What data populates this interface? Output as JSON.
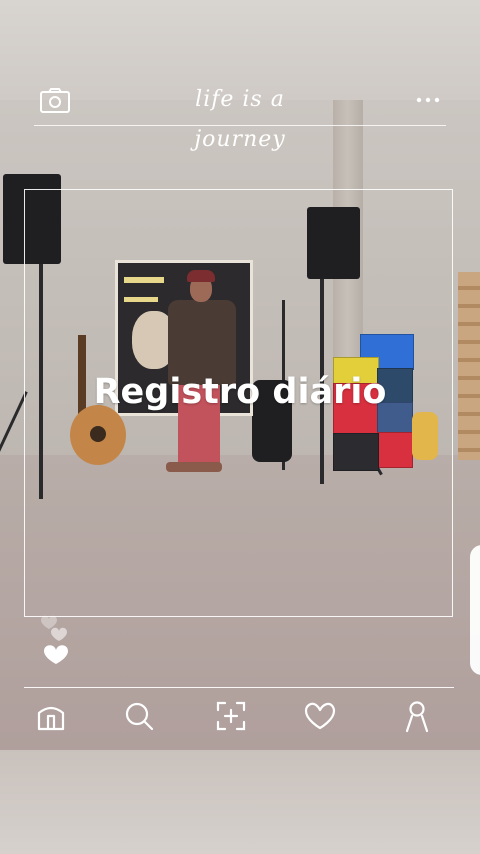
{
  "header": {
    "title": "life is a journey",
    "left_icon": "camera-icon",
    "right_icon": "more-dots-icon"
  },
  "caption": "Registro diário",
  "reactions": {
    "icon": "heart-icon"
  },
  "nav": {
    "items": [
      {
        "icon": "home-icon"
      },
      {
        "icon": "search-icon"
      },
      {
        "icon": "add-post-icon"
      },
      {
        "icon": "heart-icon"
      },
      {
        "icon": "profile-icon"
      }
    ]
  },
  "colors": {
    "overlay": "#ffffff",
    "wall": "#c7c1bb",
    "floor": "#b3a4a0"
  }
}
